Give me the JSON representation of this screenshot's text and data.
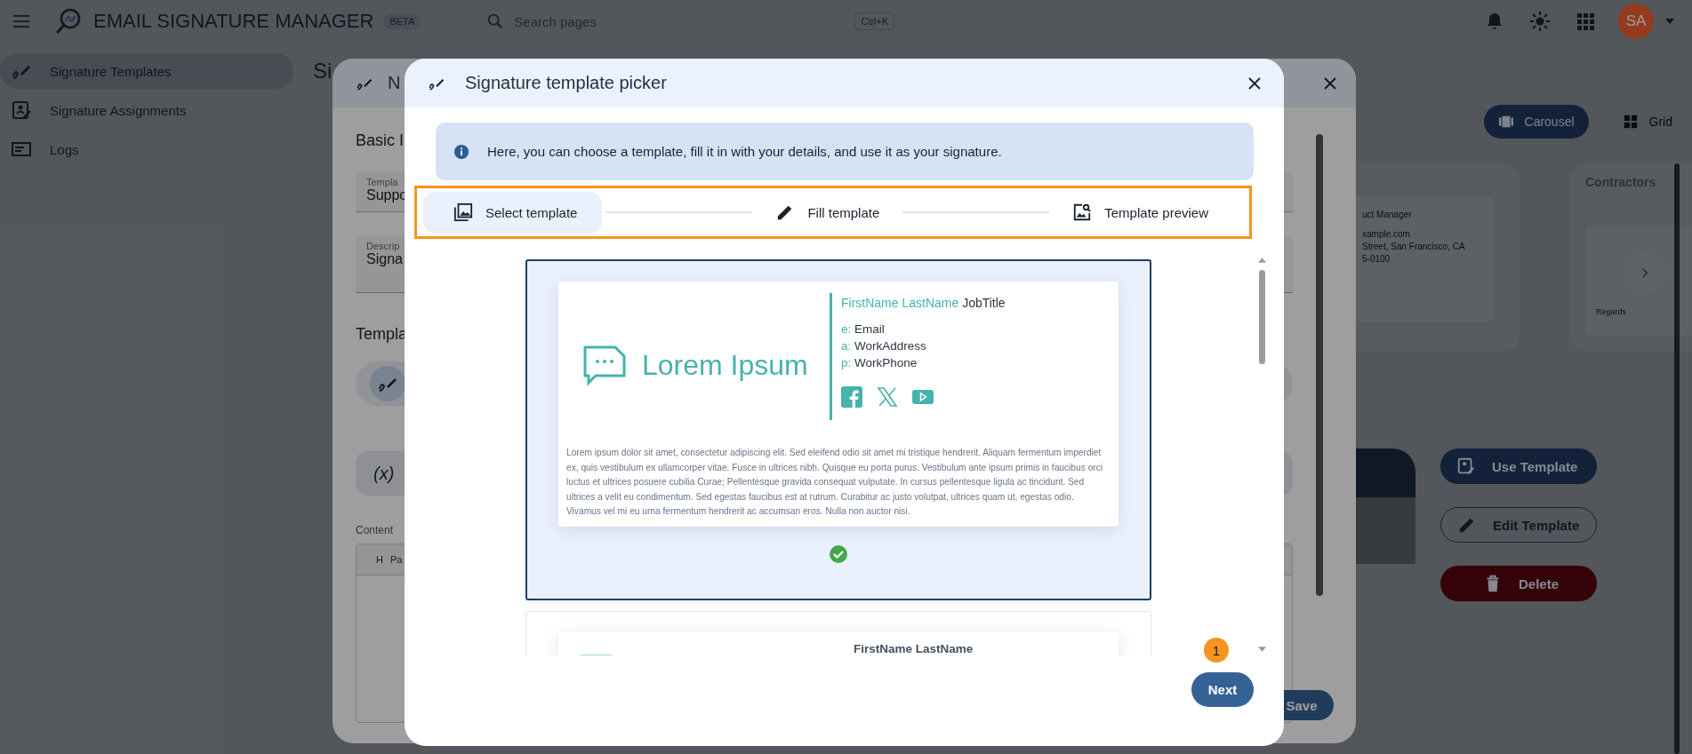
{
  "app": {
    "title": "EMAIL SIGNATURE MANAGER",
    "badge": "BETA",
    "search": {
      "placeholder": "Search pages",
      "shortcut": "Ctrl+K"
    },
    "avatar": "SA"
  },
  "sidebar": {
    "items": [
      {
        "label": "Signature Templates",
        "selected": true
      },
      {
        "label": "Signature Assignments",
        "selected": false
      },
      {
        "label": "Logs",
        "selected": false
      }
    ]
  },
  "page": {
    "heading": "Si",
    "view_toggle": [
      {
        "label": "Carousel",
        "selected": true
      },
      {
        "label": "Grid",
        "selected": false
      }
    ],
    "card_lines": [
      "uct Manager",
      "xample.com",
      "Street, San Francisco, CA",
      "5-0100"
    ],
    "card_title": "Contractors",
    "card_footer": "Regards",
    "actions": [
      {
        "label": "Use Template",
        "kind": "filled"
      },
      {
        "label": "Edit Template",
        "kind": "outlined"
      },
      {
        "label": "Delete",
        "kind": "danger"
      }
    ]
  },
  "back_dialog": {
    "title": "N",
    "section": "Basic I",
    "fields": [
      {
        "label": "Templa",
        "value": "Suppo"
      },
      {
        "label": "Descrip",
        "value": "Signa"
      }
    ],
    "template_section": "Templa",
    "variables_label": "(x)",
    "content_label": "Content",
    "toolbar": [
      "H",
      "Pa"
    ],
    "save": "Save"
  },
  "picker": {
    "title": "Signature template picker",
    "info": "Here, you can choose a template, fill it in with your details, and use it as your signature.",
    "steps": [
      {
        "label": "Select template",
        "selected": true
      },
      {
        "label": "Fill template",
        "selected": false
      },
      {
        "label": "Template preview",
        "selected": false
      }
    ],
    "templates": [
      {
        "kind": "logo-left",
        "selected": true,
        "logo": "Lorem Ipsum",
        "name": "FirstName LastName",
        "job": "JobTitle",
        "contacts": [
          {
            "prefix": "e:",
            "value": "Email"
          },
          {
            "prefix": "a:",
            "value": "WorkAddress"
          },
          {
            "prefix": "p:",
            "value": "WorkPhone"
          }
        ],
        "body": "Lorem ipsum dolor sit amet, consectetur adipiscing elit. Sed eleifend odio sit amet mi tristique hendrerit. Aliquam fermentum imperdiet ex, quis vestibulum ex ullamcorper vitae. Fusce in ultrices nibh. Quisque eu porta purus. Vestibulum ante ipsum primis in faucibus orci luctus et ultrices posuere cubilia Curae; Pellentesque gravida consequat vulputate. In cursus pellentesque ligula ac tincidunt. Sed ultrices a velit eu condimentum. Sed egestas faucibus est at rutrum. Curabitur ac justo volutpat, ultrices quam ut, egestas odio. Vivamus vel mi eu urna fermentum hendrerit ac accumsan eros. Nulla non auctor nisi."
      },
      {
        "kind": "name-only",
        "selected": false,
        "name": "FirstName LastName"
      }
    ],
    "tour_badge": "1",
    "next": "Next"
  }
}
